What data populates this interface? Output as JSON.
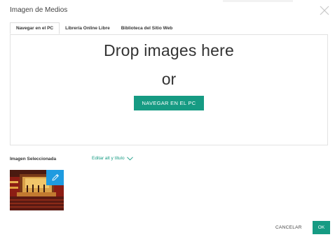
{
  "dialog": {
    "title": "Imagen de Medios"
  },
  "tabs": [
    {
      "label": "Navegar en el PC",
      "active": true
    },
    {
      "label": "Librería Online Libre",
      "active": false
    },
    {
      "label": "Biblioteca del Sitio Web",
      "active": false
    }
  ],
  "dropzone": {
    "headline": "Drop images here",
    "or": "or",
    "browse_label": "NAVEGAR EN EL PC"
  },
  "selection": {
    "label": "Imagen Seleccionada",
    "edit_link": "Editar alt y título"
  },
  "footer": {
    "cancel_label": "CANCELAR",
    "ok_label": "OK"
  },
  "colors": {
    "accent": "#169b83",
    "edit_badge": "#1e9be0"
  },
  "icons": {
    "close": "close-icon",
    "chevron": "chevron-down-icon",
    "edit": "pencil-icon"
  }
}
